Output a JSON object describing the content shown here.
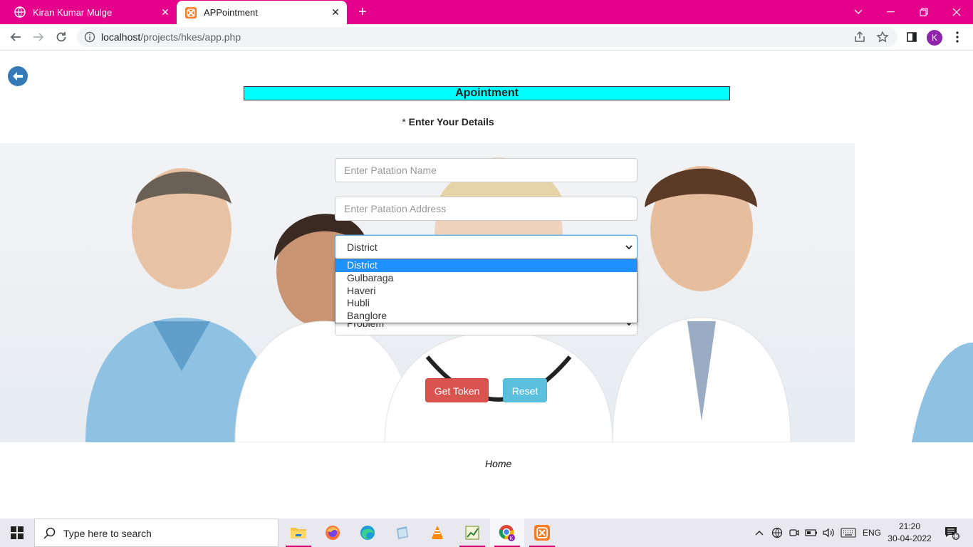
{
  "browser": {
    "tabs": [
      {
        "label": "Kiran Kumar Mulge",
        "active": false
      },
      {
        "label": "APPointment",
        "active": true
      }
    ],
    "url_host": "localhost",
    "url_path": "/projects/hkes/app.php",
    "profile_initial": "K"
  },
  "page": {
    "title": "Apointment",
    "subtitle_star": "*",
    "subtitle": "Enter Your Details",
    "form": {
      "name_placeholder": "Enter Patation Name",
      "address_placeholder": "Enter Patation Address",
      "district_selected": "District",
      "district_options": [
        "District",
        "Gulbaraga",
        "Haveri",
        "Hubli",
        "Banglore"
      ],
      "problem_selected": "Problem"
    },
    "buttons": {
      "get_token": "Get Token",
      "reset": "Reset"
    },
    "footer_link": "Home"
  },
  "taskbar": {
    "search_placeholder": "Type here to search",
    "language": "ENG",
    "time": "21:20",
    "date": "30-04-2022",
    "notification_count": "13"
  },
  "colors": {
    "tabstrip": "#e5008c",
    "title_bg": "#00ffff",
    "get_token": "#d9534f",
    "reset": "#5bc0de",
    "selected_option": "#1e90ff"
  }
}
